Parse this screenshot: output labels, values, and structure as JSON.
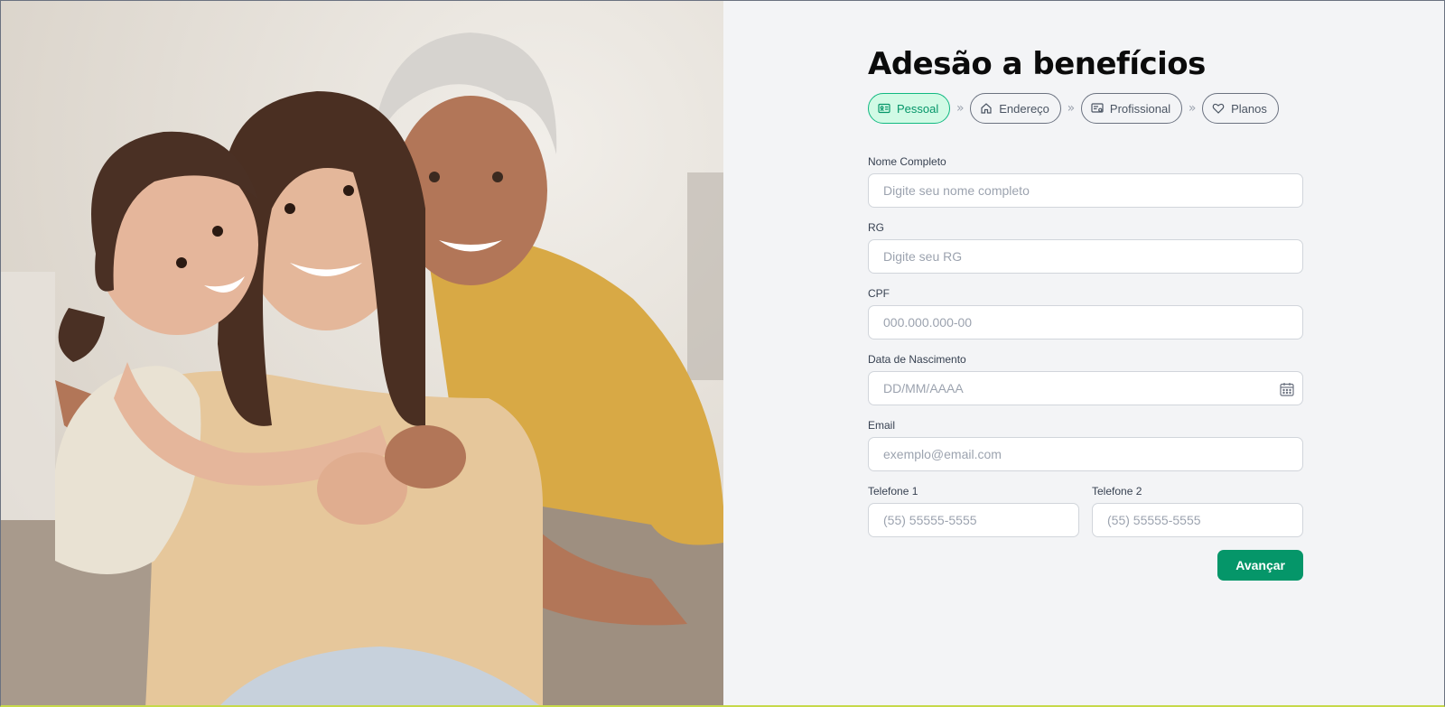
{
  "page": {
    "title": "Adesão a benefícios"
  },
  "steps": [
    {
      "label": "Pessoal",
      "icon": "id-card-icon",
      "active": true
    },
    {
      "label": "Endereço",
      "icon": "home-icon",
      "active": false
    },
    {
      "label": "Profissional",
      "icon": "briefcase-card-icon",
      "active": false
    },
    {
      "label": "Planos",
      "icon": "heart-icon",
      "active": false
    }
  ],
  "step_separator": "»",
  "form": {
    "nome": {
      "label": "Nome Completo",
      "placeholder": "Digite seu nome completo",
      "value": ""
    },
    "rg": {
      "label": "RG",
      "placeholder": "Digite seu RG",
      "value": ""
    },
    "cpf": {
      "label": "CPF",
      "placeholder": "000.000.000-00",
      "value": ""
    },
    "nascimento": {
      "label": "Data de Nascimento",
      "placeholder": "DD/MM/AAAA",
      "value": "",
      "icon": "calendar-icon"
    },
    "email": {
      "label": "Email",
      "placeholder": "exemplo@email.com",
      "value": ""
    },
    "telefone1": {
      "label": "Telefone 1",
      "placeholder": "(55) 55555-5555",
      "value": ""
    },
    "telefone2": {
      "label": "Telefone 2",
      "placeholder": "(55) 55555-5555",
      "value": ""
    },
    "submit_label": "Avançar"
  },
  "colors": {
    "accent": "#059669",
    "accent_light": "#d1fae5",
    "background": "#f3f4f6"
  }
}
